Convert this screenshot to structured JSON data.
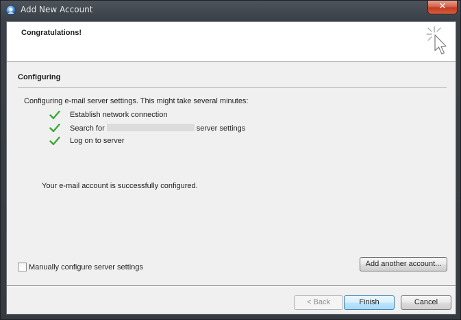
{
  "window": {
    "title": "Add New Account",
    "close_label": "✕"
  },
  "header": {
    "title": "Congratulations!"
  },
  "section": {
    "title": "Configuring",
    "intro": "Configuring e-mail server settings. This might take several minutes:",
    "steps": [
      {
        "label": "Establish network connection",
        "status": "complete"
      },
      {
        "label_before": "Search for",
        "label_after": "server settings",
        "status": "complete"
      },
      {
        "label": "Log on to server",
        "status": "complete"
      }
    ],
    "success_message": "Your e-mail account is successfully configured."
  },
  "options": {
    "manual_configure_label": "Manually configure server settings",
    "manual_configure_checked": false,
    "add_another_label": "Add another account..."
  },
  "footer": {
    "back_label": "< Back",
    "finish_label": "Finish",
    "cancel_label": "Cancel"
  },
  "colors": {
    "check_green": "#39a832",
    "finish_border": "#3c7fb1"
  },
  "icons": {
    "app": "outlook-app-icon",
    "header": "click-cursor-icon",
    "check": "check-icon",
    "close": "close-icon"
  }
}
